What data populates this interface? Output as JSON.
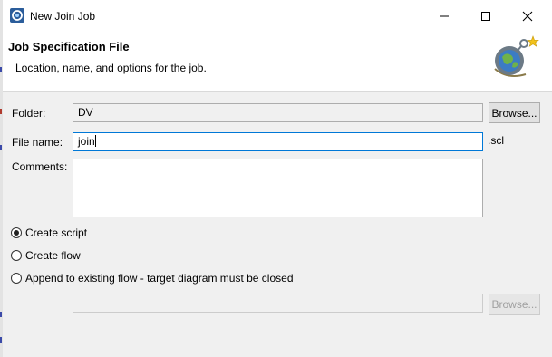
{
  "window": {
    "title": "New Join Job",
    "minimize_icon": "minimize-icon",
    "maximize_icon": "maximize-icon",
    "close_icon": "close-icon"
  },
  "banner": {
    "title": "Job Specification File",
    "description": "Location, name, and options for the job.",
    "icon": "wizard-globe-icon"
  },
  "form": {
    "folder_label": "Folder:",
    "folder_value": "DV",
    "folder_browse_label": "Browse...",
    "filename_label": "File name:",
    "filename_value": "join",
    "filename_suffix": ".scl",
    "comments_label": "Comments:",
    "comments_value": ""
  },
  "options": {
    "create_script": {
      "label": "Create script",
      "selected": true
    },
    "create_flow": {
      "label": "Create flow",
      "selected": false
    },
    "append_flow": {
      "label": "Append to existing flow - target diagram must be closed",
      "selected": false
    }
  },
  "append": {
    "flow_value": "",
    "browse_label": "Browse...",
    "enabled": false
  },
  "colors": {
    "focus_border": "#0078d7",
    "dialog_background": "#f0f0f0",
    "banner_background": "#ffffff"
  }
}
